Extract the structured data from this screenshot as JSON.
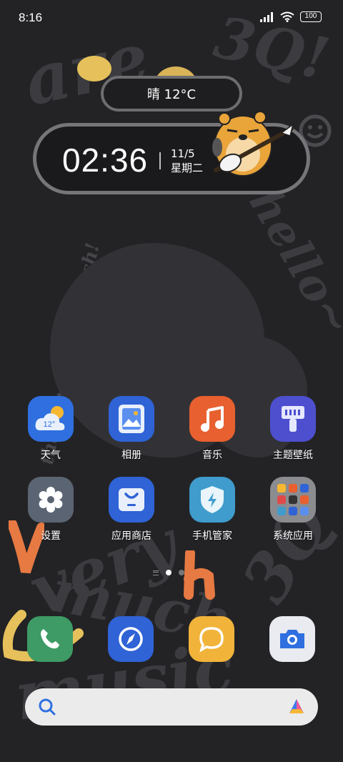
{
  "status_bar": {
    "time": "8:16",
    "battery": "100",
    "icons": [
      "signal-icon",
      "wifi-icon",
      "battery-icon"
    ]
  },
  "weather_widget": {
    "text": "晴 12°C"
  },
  "clock_widget": {
    "time": "02:36",
    "date": "11/5",
    "weekday": "星期二"
  },
  "apps": [
    {
      "label": "天气",
      "icon": "weather-icon",
      "color": "#2f6fe0",
      "badge": "12°"
    },
    {
      "label": "相册",
      "icon": "gallery-icon",
      "color": "#2f63d6"
    },
    {
      "label": "音乐",
      "icon": "music-icon",
      "color": "#e8602f"
    },
    {
      "label": "主题壁纸",
      "icon": "theme-icon",
      "color": "#4e4fcf"
    },
    {
      "label": "设置",
      "icon": "settings-icon",
      "color": "#5b6472"
    },
    {
      "label": "应用商店",
      "icon": "app-store-icon",
      "color": "#2f63d6"
    },
    {
      "label": "手机管家",
      "icon": "security-icon",
      "color": "#3f9ccc"
    },
    {
      "label": "系统应用",
      "icon": "folder-icon",
      "color": "#8a8c90"
    }
  ],
  "dock": [
    {
      "icon": "phone-icon",
      "color": "#3e9b65"
    },
    {
      "icon": "browser-icon",
      "color": "#2f63d6"
    },
    {
      "icon": "messages-icon",
      "color": "#f1b33a"
    },
    {
      "icon": "camera-icon",
      "color": "#e9ebf0"
    }
  ],
  "search": {
    "placeholder": ""
  },
  "colors": {
    "background": "#232326",
    "accent_yellow": "#e6c15b",
    "accent_orange": "#e77942"
  }
}
